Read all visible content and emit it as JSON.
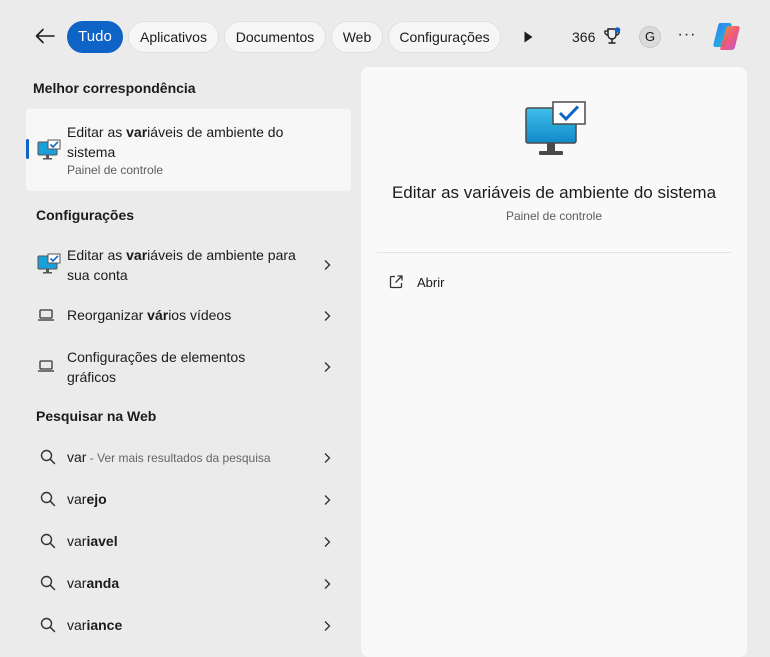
{
  "topbar": {
    "back_icon": "arrow-left-icon",
    "filters": [
      "Tudo",
      "Aplicativos",
      "Documentos",
      "Web",
      "Configurações"
    ],
    "active_filter": "Tudo",
    "play_icon": "play-icon",
    "points": "366",
    "trophy_icon": "trophy-icon",
    "avatar_letter": "G",
    "more_label": "···",
    "copilot_icon": "copilot-icon"
  },
  "left": {
    "best_match_heading": "Melhor correspondência",
    "best_match": {
      "title_pre": "Editar as ",
      "title_bold": "var",
      "title_post": "iáveis de ambiente do sistema",
      "subtitle": "Painel de controle",
      "icon": "monitor-check-icon"
    },
    "settings_heading": "Configurações",
    "settings_items": [
      {
        "pre": "Editar as ",
        "bold": "var",
        "post": "iáveis de ambiente para sua conta",
        "icon": "monitor-check-icon"
      },
      {
        "pre": "Reorganizar ",
        "bold": "vár",
        "post": "ios vídeos",
        "icon": "laptop-icon"
      },
      {
        "pre": "",
        "bold": "",
        "post": "Configurações de elementos gráficos",
        "icon": "laptop-icon"
      }
    ],
    "web_heading": "Pesquisar na Web",
    "web_items": [
      {
        "pre": "var",
        "bold": "",
        "muted": " - Ver mais resultados da pesquisa",
        "icon": "search-icon"
      },
      {
        "pre": "var",
        "bold": "ejo",
        "muted": "",
        "icon": "search-icon"
      },
      {
        "pre": "var",
        "bold": "iavel",
        "muted": "",
        "icon": "search-icon"
      },
      {
        "pre": "var",
        "bold": "anda",
        "muted": "",
        "icon": "search-icon"
      },
      {
        "pre": "var",
        "bold": "iance",
        "muted": "",
        "icon": "search-icon"
      }
    ]
  },
  "detail": {
    "title": "Editar as variáveis de ambiente do sistema",
    "subtitle": "Painel de controle",
    "open_label": "Abrir",
    "open_icon": "open-external-icon"
  },
  "colors": {
    "accent": "#0d63c6",
    "background": "#ecebeb",
    "panel": "#f9f9f9"
  }
}
